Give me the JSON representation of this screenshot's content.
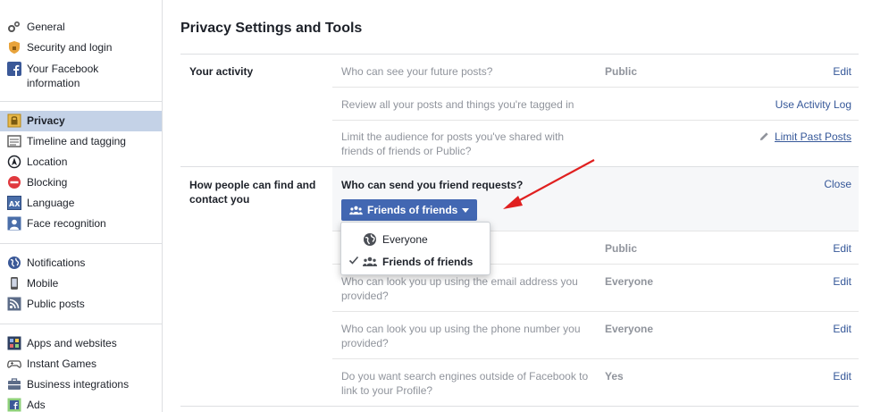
{
  "sidebar": {
    "groups": [
      [
        {
          "label": "General",
          "icon": "gears-icon"
        },
        {
          "label": "Security and login",
          "icon": "shield-icon"
        },
        {
          "label": "Your Facebook information",
          "icon": "facebook-icon"
        }
      ],
      [
        {
          "label": "Privacy",
          "icon": "lock-icon",
          "active": true
        },
        {
          "label": "Timeline and tagging",
          "icon": "timeline-icon"
        },
        {
          "label": "Location",
          "icon": "location-icon"
        },
        {
          "label": "Blocking",
          "icon": "blocking-icon"
        },
        {
          "label": "Language",
          "icon": "language-icon"
        },
        {
          "label": "Face recognition",
          "icon": "face-recognition-icon"
        }
      ],
      [
        {
          "label": "Notifications",
          "icon": "globe-icon"
        },
        {
          "label": "Mobile",
          "icon": "mobile-icon"
        },
        {
          "label": "Public posts",
          "icon": "rss-icon"
        }
      ],
      [
        {
          "label": "Apps and websites",
          "icon": "apps-icon"
        },
        {
          "label": "Instant Games",
          "icon": "gamepad-icon"
        },
        {
          "label": "Business integrations",
          "icon": "business-icon"
        },
        {
          "label": "Ads",
          "icon": "ads-icon"
        }
      ]
    ]
  },
  "main": {
    "title": "Privacy Settings and Tools",
    "activity": {
      "label": "Your activity",
      "rows": [
        {
          "q": "Who can see your future posts?",
          "v": "Public",
          "a": "Edit"
        },
        {
          "q": "Review all your posts and things you're tagged in",
          "v": "",
          "a": "Use Activity Log"
        },
        {
          "q": "Limit the audience for posts you've shared with friends of friends or Public?",
          "v": "",
          "a": "Limit Past Posts"
        }
      ]
    },
    "find": {
      "label": "How people can find and contact you",
      "open": {
        "q": "Who can send you friend requests?",
        "close": "Close",
        "button": "Friends of friends"
      },
      "rows": [
        {
          "q": "",
          "v": "Public",
          "a": "Edit"
        },
        {
          "q": "Who can look you up using the email address you provided?",
          "v": "Everyone",
          "a": "Edit"
        },
        {
          "q": "Who can look you up using the phone number you provided?",
          "v": "Everyone",
          "a": "Edit"
        },
        {
          "q": "Do you want search engines outside of Facebook to link to your Profile?",
          "v": "Yes",
          "a": "Edit"
        }
      ]
    },
    "dropdown": {
      "options": [
        {
          "label": "Everyone",
          "icon": "globe-icon",
          "checked": false
        },
        {
          "label": "Friends of friends",
          "icon": "friends-icon",
          "checked": true
        }
      ]
    }
  },
  "colors": {
    "accent": "#4267b2",
    "link": "#365899",
    "active_bg": "#c4d2e7",
    "arrow": "#e02020"
  }
}
